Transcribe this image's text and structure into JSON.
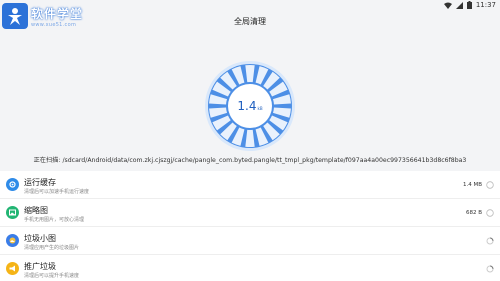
{
  "status": {
    "time": "11:37"
  },
  "watermark": {
    "title": "软件学堂",
    "subtitle": "www.xue51.com"
  },
  "header": {
    "title": "全局清理"
  },
  "gauge": {
    "value": "1.4",
    "unit": "kB"
  },
  "scan": {
    "label": "正在扫描:",
    "path": "/sdcard/Android/data/com.zkj.cjszgj/cache/pangle_com.byted.pangle/tt_tmpl_pkg/template/f097aa4a00ec997356641b3d8c6f8ba3"
  },
  "items": [
    {
      "title": "运行缓存",
      "subtitle": "清理后可以加速手机运行速度",
      "size": "1.4 MB",
      "color": "#2f8be8",
      "icon": "rocket-icon",
      "state": "checked"
    },
    {
      "title": "缩略图",
      "subtitle": "手机无用图片，可放心清理",
      "size": "682 B",
      "color": "#22b573",
      "icon": "image-icon",
      "state": "checked"
    },
    {
      "title": "垃圾小图",
      "subtitle": "清理应用产生的垃圾图片",
      "size": "",
      "color": "#3a7de8",
      "icon": "picture-icon",
      "state": "loading"
    },
    {
      "title": "推广垃圾",
      "subtitle": "清理后可以提升手机速度",
      "size": "",
      "color": "#f5b417",
      "icon": "megaphone-icon",
      "state": "loading"
    }
  ]
}
